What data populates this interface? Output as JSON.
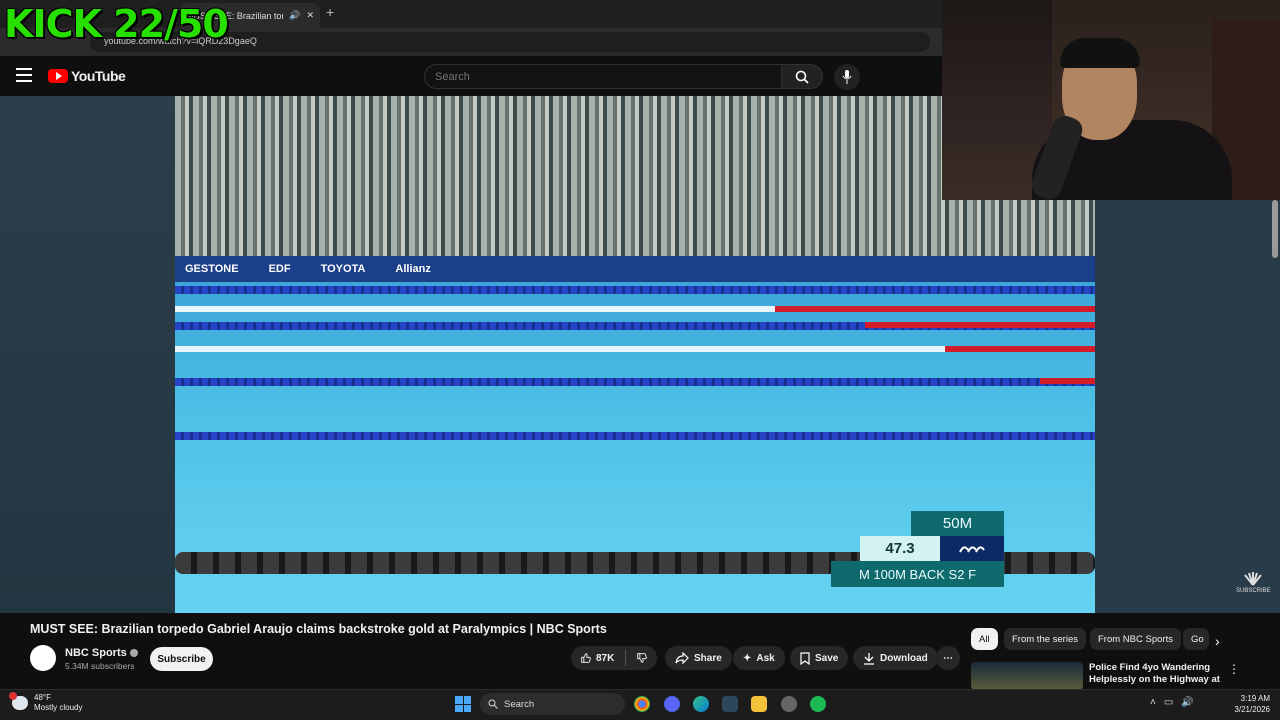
{
  "browser": {
    "tab_title": "MUST SEE: Brazilian torpedo",
    "address": "youtube.com/watch?v=iQRD23DgaeQ"
  },
  "overlay": {
    "kick_counter": "KICK 22/50"
  },
  "youtube": {
    "logo_text": "YouTube",
    "search_placeholder": "Search"
  },
  "video": {
    "ads": [
      "GESTONE",
      "EDF",
      "TOYOTA",
      "Allianz"
    ],
    "scoreboard": {
      "distance": "50M",
      "time": "47.3",
      "event": "M 100M BACK S2 F"
    },
    "watermark": "SUBSCRIBE"
  },
  "info": {
    "title": "MUST SEE: Brazilian torpedo Gabriel Araujo claims backstroke gold at Paralympics | NBC Sports",
    "channel": "NBC Sports",
    "subscribers": "5.34M subscribers",
    "subscribe_label": "Subscribe",
    "likes": "87K",
    "share_label": "Share",
    "ask_label": "Ask",
    "save_label": "Save",
    "download_label": "Download"
  },
  "chips": [
    "All",
    "From the series",
    "From NBC Sports",
    "Go"
  ],
  "recommended": {
    "title": "Police Find 4yo Wandering Helplessly on the Highway at ..."
  },
  "taskbar": {
    "weather_temp": "48°F",
    "weather_desc": "Mostly cloudy",
    "search_label": "Search",
    "time": "3:19 AM",
    "date": "3/21/2026"
  }
}
